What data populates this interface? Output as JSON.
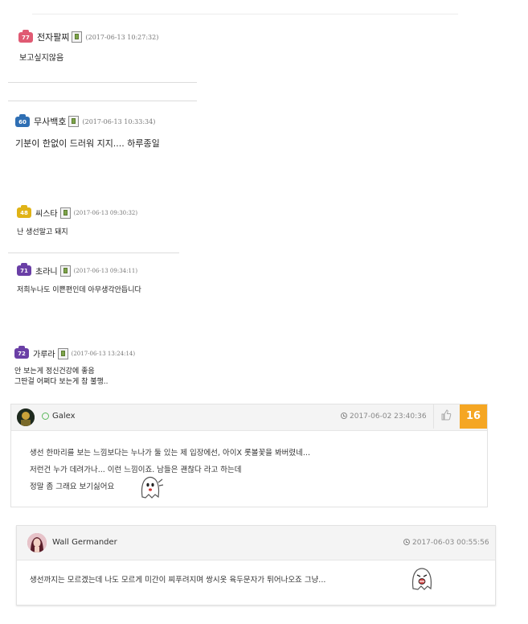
{
  "comments": [
    {
      "nick": "전자팔찌",
      "level": "77",
      "level_color": "#e05a73",
      "time": "(2017-06-13 10:27:32)",
      "text": "보고싶지않음"
    },
    {
      "nick": "무사백호",
      "level": "60",
      "level_color": "#2f6fb4",
      "time": "(2017-06-13 10:33:34)",
      "text": "기분이 한없이 드러워 지지.... 하루종일"
    },
    {
      "nick": "씨스타",
      "level": "48",
      "level_color": "#e0b316",
      "time": "(2017-06-13 09:30:32)",
      "text": "난 생선말고 돼지"
    },
    {
      "nick": "초라니",
      "level": "71",
      "level_color": "#6a3fa6",
      "time": "(2017-06-13 09:34:11)",
      "text": "저희누나도 이쁜편인데 아무생각안듭니다"
    },
    {
      "nick": "가루라",
      "level": "72",
      "level_color": "#6a3fa6",
      "time": "(2017-06-13 13:24:14)",
      "text_lines": [
        "안 보는게 정신건강에 좋음",
        "그딴걸 어쩌다 보는게 참 불행.."
      ]
    }
  ],
  "reply_galex": {
    "name": "Galex",
    "date": "2017-06-02 23:40:36",
    "likes": "16",
    "lines": [
      "생선 한마리를 보는 느낌보다는 누나가 둘 있는 제 입장에선, 아이X 롯볼꽃을 봐버렸네...",
      "저런건 누가 데려가나... 이런 느낌이죠. 남들은 괜찮다 라고 하는데",
      "정말 좀 그래요 보기싫어요"
    ]
  },
  "reply_wall": {
    "name": "Wall Germander",
    "date": "2017-06-03 00:55:56",
    "text": "생선까지는 모르겠는데 나도 모르게 미간이 찌푸려지며 쌍시옷 육두문자가 튀어나오죠 그냥..."
  },
  "icons": {
    "level_badge": "level-badge-icon",
    "phone": "mobile-phone-icon",
    "clock": "clock-icon",
    "thumb": "thumbs-up-icon",
    "emoticon": "ghost-emoticon"
  }
}
